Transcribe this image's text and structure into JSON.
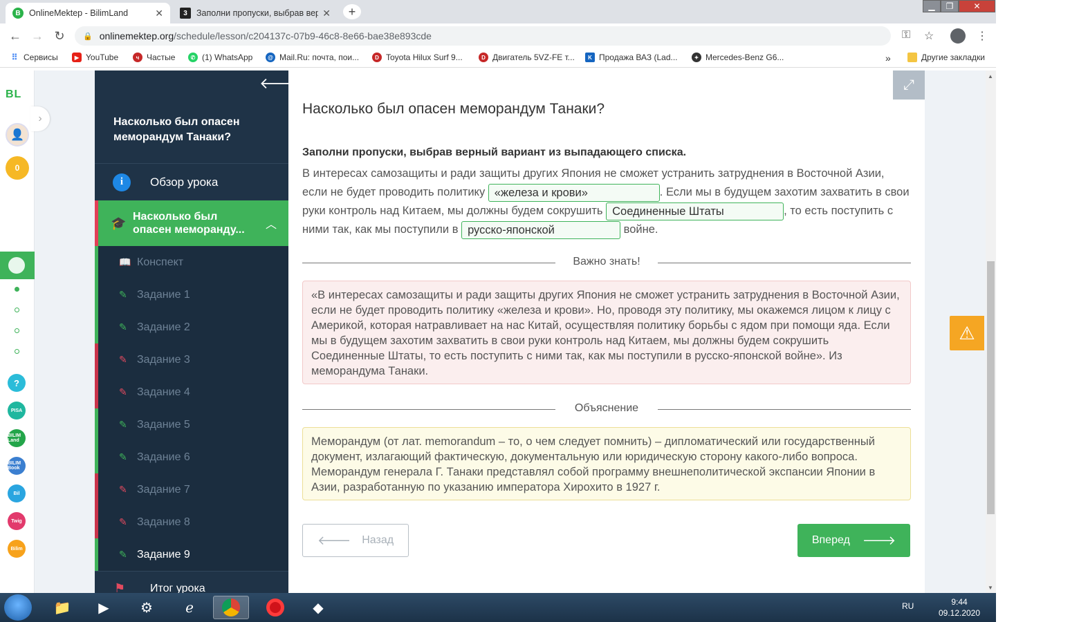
{
  "browser": {
    "tabs": [
      {
        "title": "OnlineMektep - BilimLand",
        "favicon": "B",
        "active": true
      },
      {
        "title": "Заполни пропуски, выбрав вер",
        "favicon": "3",
        "active": false
      }
    ],
    "new_tab_icon": "+",
    "url_domain": "onlinemektep.org",
    "url_path": "/schedule/lesson/c204137c-07b9-46c8-8e66-bae38e893cde",
    "bookmarks": [
      {
        "label": "Сервисы",
        "icon": "apps-grid-icon"
      },
      {
        "label": "YouTube",
        "icon": "youtube-icon"
      },
      {
        "label": "Частые",
        "icon": "frequent-icon"
      },
      {
        "label": "(1) WhatsApp",
        "icon": "whatsapp-icon"
      },
      {
        "label": "Mail.Ru: почта, пои...",
        "icon": "mailru-icon"
      },
      {
        "label": "Toyota Hilux Surf 9...",
        "icon": "toyota-icon"
      },
      {
        "label": "Двигатель 5VZ-FE т...",
        "icon": "engine-icon"
      },
      {
        "label": "Продажа ВАЗ (Lad...",
        "icon": "kolesa-icon"
      },
      {
        "label": "Mercedes-Benz G6...",
        "icon": "mercedes-icon"
      }
    ],
    "bookmarks_more": "»",
    "other_bookmarks": "Другие закладки"
  },
  "rail": {
    "logo": "BL",
    "coins": "0",
    "apps": [
      {
        "label": "?",
        "color": "#2bbcd9"
      },
      {
        "label": "PISA",
        "color": "#1fb79f"
      },
      {
        "label": "BILIM Land",
        "color": "#23a54a"
      },
      {
        "label": "BILIM Book",
        "color": "#3b7fd0"
      },
      {
        "label": "Bil",
        "color": "#2aa5e0"
      },
      {
        "label": "Twig",
        "color": "#e23a6c"
      },
      {
        "label": "Bilim",
        "color": "#f7a21b"
      }
    ]
  },
  "sidebar": {
    "title": "Насколько был опасен меморандум Танаки?",
    "overview": "Обзор урока",
    "current_section": "Насколько был опасен меморанду...",
    "items": [
      {
        "label": "Конспект",
        "status": "green",
        "icon": "book-icon"
      },
      {
        "label": "Задание 1",
        "status": "green",
        "icon": "edit-icon"
      },
      {
        "label": "Задание 2",
        "status": "green",
        "icon": "edit-icon"
      },
      {
        "label": "Задание 3",
        "status": "red",
        "icon": "edit-icon"
      },
      {
        "label": "Задание 4",
        "status": "red",
        "icon": "edit-icon"
      },
      {
        "label": "Задание 5",
        "status": "green",
        "icon": "edit-icon"
      },
      {
        "label": "Задание 6",
        "status": "green",
        "icon": "edit-icon"
      },
      {
        "label": "Задание 7",
        "status": "red",
        "icon": "edit-icon"
      },
      {
        "label": "Задание 8",
        "status": "red",
        "icon": "edit-icon"
      },
      {
        "label": "Задание 9",
        "status": "green",
        "icon": "edit-icon",
        "current": true
      }
    ],
    "final": "Итог урока"
  },
  "content": {
    "heading": "Насколько был опасен меморандум Танаки?",
    "instruction": "Заполни пропуски, выбрав верный вариант из выпадающего списка.",
    "text_1": "В интересах самозащиты и ради защиты других Япония не сможет устранить затруднения в Восточной Азии, если не будет проводить политику",
    "blank_1": "«железа и крови»",
    "text_2": ". Если мы в будущем захотим захватить в свои руки контроль над Китаем, мы должны будем сокрушить",
    "blank_2": "Соединенные Штаты",
    "text_3": ", то есть поступить с ними так, как мы поступили в",
    "blank_3": "русско-японской",
    "text_4": "войне.",
    "important_label": "Важно знать!",
    "important_text": "«В интересах самозащиты и ради защиты других Япония не сможет устранить затруднения в Восточной Азии, если не будет проводить политику «железа и крови». Но, проводя эту политику, мы окажемся лицом к лицу с Америкой, которая натравливает на нас Китай, осуществляя политику борьбы с ядом при помощи яда. Если мы в будущем захотим захватить в свои руки контроль над Китаем, мы должны будем сокрушить Соединенные Штаты, то есть поступить с ними так, как мы поступили в русско-японской войне». Из меморандума Танаки.",
    "explanation_label": "Объяснение",
    "explanation_text": "Меморандум (от лат. memorandum – то, о чем следует помнить) – дипломатический или государственный документ, излагающий фактическую, документальную или юридическую сторону какого-либо вопроса. Меморандум генерала Г. Танаки представлял собой программу внешнеполитической экспансии Японии в Азии, разработанную по указанию императора Хирохито в 1927 г.",
    "back_label": "Назад",
    "next_label": "Вперед"
  },
  "taskbar": {
    "lang": "RU",
    "time": "9:44",
    "date": "09.12.2020"
  },
  "colors": {
    "accent_green": "#3fb35a",
    "sidebar_bg": "#1f3347",
    "error_red": "#e24a5f",
    "warning_orange": "#f5a623"
  }
}
